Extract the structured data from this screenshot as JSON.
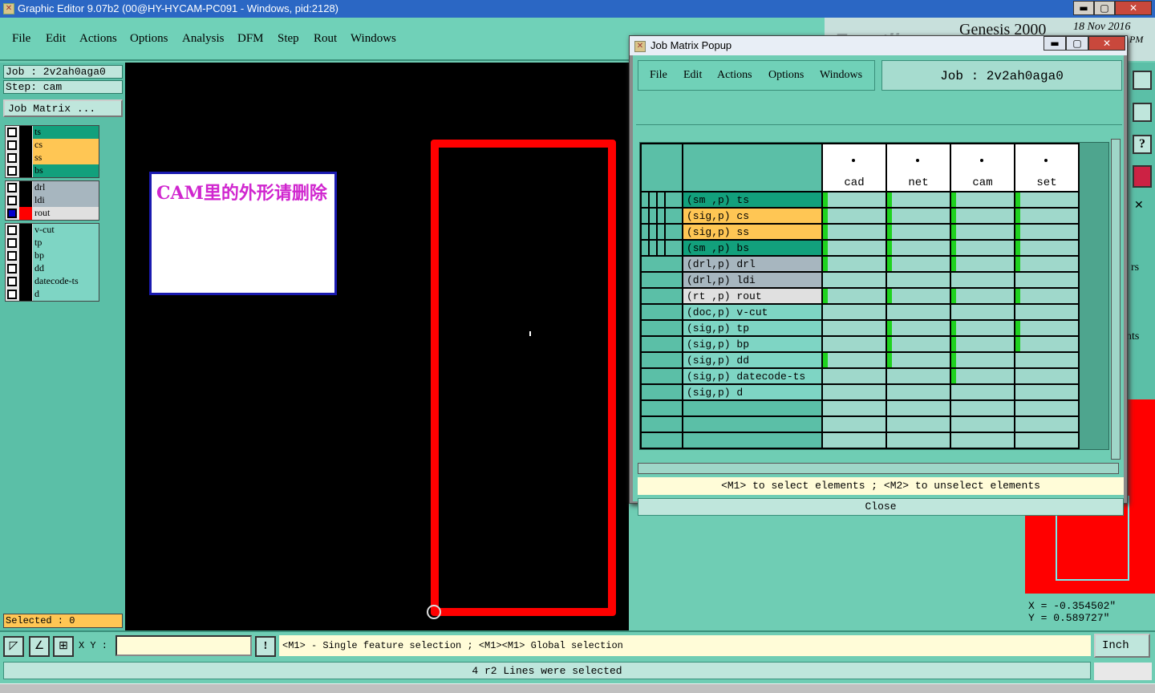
{
  "window": {
    "title": "Graphic Editor 9.07b2 (00@HY-HYCAM-PC091 - Windows, pid:2128)",
    "min": "▬",
    "max": "▢",
    "close": "✕"
  },
  "menu": [
    "File",
    "Edit",
    "Actions",
    "Options",
    "Analysis",
    "DFM",
    "Step",
    "Rout",
    "Windows"
  ],
  "header_right": {
    "brand": "Frontline",
    "product": "Genesis 2000",
    "date": "18 Nov 2016",
    "time_suffix": "PM"
  },
  "left_panel": {
    "job": "Job : 2v2ah0aga0",
    "step": "Step: cam",
    "job_matrix_button": "Job Matrix ...",
    "selected": "Selected : 0",
    "layers": [
      {
        "name": "ts",
        "color": "#12a07c"
      },
      {
        "name": "cs",
        "color": "#ffc654"
      },
      {
        "name": "ss",
        "color": "#ffc654"
      },
      {
        "name": "bs",
        "color": "#12a07c"
      },
      {
        "name": "drl",
        "color": "#a7b6bf"
      },
      {
        "name": "ldi",
        "color": "#a7b6bf"
      },
      {
        "name": "rout",
        "color": "#e0e0e0"
      },
      {
        "name": "v-cut",
        "color": "#7ed5c4"
      },
      {
        "name": "tp",
        "color": "#7ed5c4"
      },
      {
        "name": "bp",
        "color": "#7ed5c4"
      },
      {
        "name": "dd",
        "color": "#7ed5c4"
      },
      {
        "name": "datecode-ts",
        "color": "#7ed5c4"
      },
      {
        "name": "d",
        "color": "#7ed5c4"
      }
    ]
  },
  "canvas": {
    "note_text": "CAM里的外形请删除"
  },
  "coords": {
    "x": "X = -0.354502\"",
    "y": "Y = 0.589727\""
  },
  "right_strip": {
    "frag1": "rs",
    "frag2": "nts"
  },
  "bottom": {
    "xy_label": "X Y :",
    "xy_value": "",
    "warn": "!",
    "message": "<M1> - Single feature selection ; <M1><M1> Global selection",
    "units": "Inch",
    "status": "4 r2 Lines were selected"
  },
  "popup": {
    "title": "Job Matrix Popup",
    "menu": [
      "File",
      "Edit",
      "Actions",
      "Options",
      "Windows"
    ],
    "job": "Job : 2v2ah0aga0",
    "columns": [
      "cad",
      "net",
      "cam",
      "set"
    ],
    "rows": [
      {
        "label": "(sm ,p) ts",
        "color": "#12a07c",
        "marks": [
          1,
          1,
          1,
          1
        ]
      },
      {
        "label": "(sig,p) cs",
        "color": "#ffc654",
        "marks": [
          1,
          1,
          1,
          1
        ]
      },
      {
        "label": "(sig,p) ss",
        "color": "#ffc654",
        "marks": [
          1,
          1,
          1,
          1
        ]
      },
      {
        "label": "(sm ,p) bs",
        "color": "#12a07c",
        "marks": [
          1,
          1,
          1,
          1
        ]
      },
      {
        "label": "(drl,p) drl",
        "color": "#a7b6bf",
        "marks": [
          1,
          1,
          1,
          1
        ]
      },
      {
        "label": "(drl,p) ldi",
        "color": "#a7b6bf",
        "marks": [
          0,
          0,
          0,
          0
        ]
      },
      {
        "label": "(rt ,p) rout",
        "color": "#e0e0e0",
        "marks": [
          1,
          1,
          1,
          1
        ]
      },
      {
        "label": "(doc,p) v-cut",
        "color": "#7ed5c4",
        "marks": [
          0,
          0,
          0,
          0
        ]
      },
      {
        "label": "(sig,p) tp",
        "color": "#7ed5c4",
        "marks": [
          0,
          1,
          1,
          1
        ]
      },
      {
        "label": "(sig,p) bp",
        "color": "#7ed5c4",
        "marks": [
          0,
          1,
          1,
          1
        ]
      },
      {
        "label": "(sig,p) dd",
        "color": "#7ed5c4",
        "marks": [
          1,
          1,
          1,
          0
        ]
      },
      {
        "label": "(sig,p) datecode-ts",
        "color": "#7ed5c4",
        "marks": [
          0,
          0,
          1,
          0
        ]
      },
      {
        "label": "(sig,p) d",
        "color": "#7ed5c4",
        "marks": [
          0,
          0,
          0,
          0
        ]
      },
      {
        "label": "",
        "color": "#5bbfa7",
        "marks": [
          0,
          0,
          0,
          0
        ]
      },
      {
        "label": "",
        "color": "#5bbfa7",
        "marks": [
          0,
          0,
          0,
          0
        ]
      },
      {
        "label": "",
        "color": "#5bbfa7",
        "marks": [
          0,
          0,
          0,
          0
        ]
      }
    ],
    "hint": "<M1> to select elements ; <M2> to unselect elements",
    "close": "Close"
  }
}
